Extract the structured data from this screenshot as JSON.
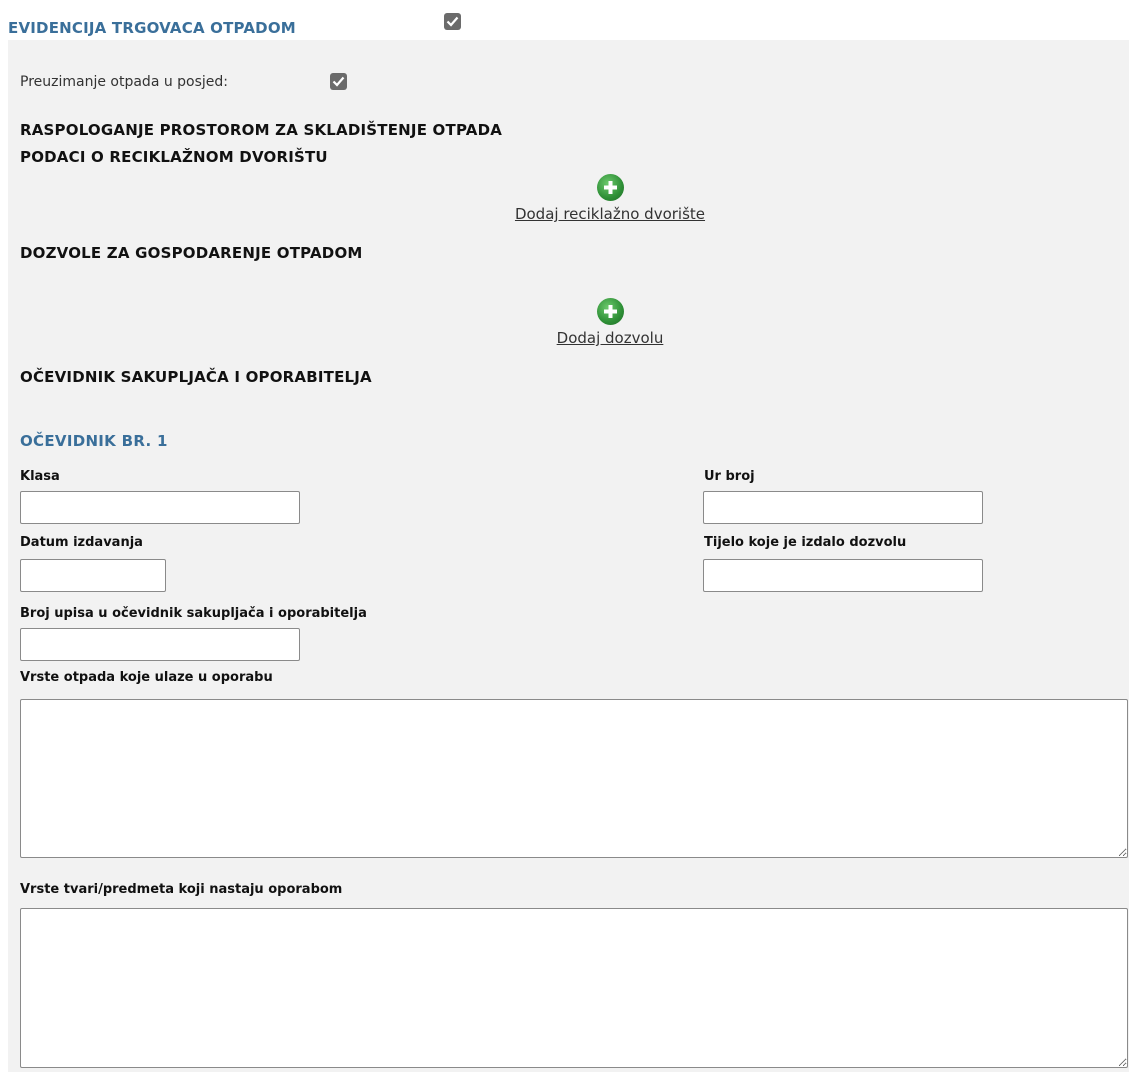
{
  "header": {
    "title": "EVIDENCIJA TRGOVACA OTPADOM",
    "checked": true
  },
  "preuzimanje": {
    "label": "Preuzimanje otpada u posjed:",
    "checked": true
  },
  "sections": {
    "raspolaganje": "RASPOLOGANJE PROSTOROM ZA SKLADIŠTENJE OTPADA",
    "reciklazno": "PODACI O RECIKLAŽNOM DVORIŠTU",
    "dozvole": "DOZVOLE ZA GOSPODARENJE OTPADOM",
    "ocevidnik": "OČEVIDNIK SAKUPLJAČA I OPORABITELJA"
  },
  "actions": {
    "add_reciklazno": "Dodaj reciklažno dvorište",
    "add_dozvola": "Dodaj dozvolu"
  },
  "ocevidnik_form": {
    "title": "OČEVIDNIK BR. 1",
    "klasa_label": "Klasa",
    "klasa_value": "",
    "ur_broj_label": "Ur broj",
    "ur_broj_value": "",
    "datum_label": "Datum izdavanja",
    "datum_value": "",
    "tijelo_label": "Tijelo koje je izdalo dozvolu",
    "tijelo_value": "",
    "broj_upisa_label": "Broj upisa u očevidnik sakupljača i oporabitelja",
    "broj_upisa_value": "",
    "vrste_otpada_label": "Vrste otpada koje ulaze u oporabu",
    "vrste_otpada_value": "",
    "vrste_tvari_label": "Vrste tvari/predmeta koji nastaju oporabom",
    "vrste_tvari_value": ""
  }
}
